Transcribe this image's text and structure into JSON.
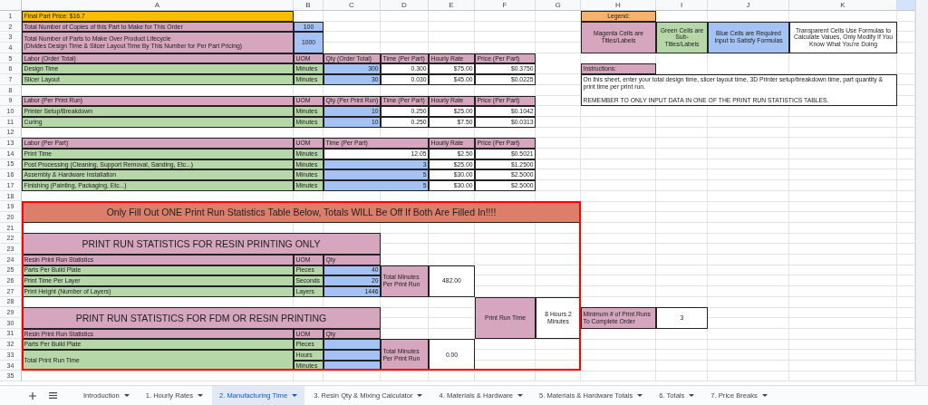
{
  "columns": [
    "A",
    "B",
    "C",
    "D",
    "E",
    "F",
    "G",
    "H",
    "I",
    "J",
    "K"
  ],
  "row_numbers": [
    "1",
    "2",
    "3",
    "4",
    "5",
    "6",
    "7",
    "8",
    "9",
    "10",
    "11",
    "12",
    "13",
    "14",
    "15",
    "16",
    "17",
    "18",
    "19",
    "20",
    "21",
    "22",
    "23",
    "24",
    "25",
    "26",
    "27",
    "28",
    "29",
    "30",
    "31",
    "32",
    "33",
    "34",
    "35"
  ],
  "sections": [
    {
      "cells": [
        {
          "kind": "price",
          "text": "Final Part Price: $16.7"
        },
        {
          "kind": "title",
          "text": "Total Number of Copies of this Part to Make for This Order"
        },
        {
          "kind": "input-centered",
          "text": "100"
        },
        {
          "kind": "title",
          "text": "Total Number of Parts to Make Over Product Lifecycle\n(Divides Design Time & Slicer Layout Time By This Number for Per Part Pricing)"
        },
        {
          "kind": "input-centered",
          "text": "1000"
        }
      ]
    },
    {
      "cells": [
        {
          "kind": "legend-title",
          "text": "Legend:"
        },
        {
          "kind": "title-centered",
          "text": "Magenta Cells are Titles/Labels"
        },
        {
          "kind": "subtitle-centered",
          "text": "Green Cells are Sub-Titles/Labels"
        },
        {
          "kind": "input-centered",
          "text": "Blue Cells are Required Input to Satisfy Formulas"
        },
        {
          "kind": "value-centered",
          "text": "Transparent Cells Use Formulas to Calculate Values, Only Modify If You Know What You're Doing"
        }
      ]
    },
    {
      "cells": [
        {
          "kind": "title",
          "text": "Instructions:"
        },
        {
          "kind": "note",
          "text": "On this sheet, enter your total design time, slicer layout time, 3D Printer setup/breakdown time, part quantity & print time per print run.\n\nREMEMBER TO ONLY INPUT DATA IN ONE OF THE PRINT RUN STATISTICS TABLES."
        }
      ]
    },
    {
      "cells": [
        {
          "kind": "title",
          "text": "Labor (Order Total)"
        },
        {
          "kind": "title",
          "text": "UOM"
        },
        {
          "kind": "title",
          "text": "Qty (Order Total)"
        },
        {
          "kind": "title",
          "text": "Time (Per Part)"
        },
        {
          "kind": "title",
          "text": "Hourly Rate"
        },
        {
          "kind": "title",
          "text": "Price (Per Part)"
        },
        {
          "kind": "subtitle",
          "text": "Design Time"
        },
        {
          "kind": "subtitle",
          "text": "Minutes"
        },
        {
          "kind": "input",
          "text": "300"
        },
        {
          "kind": "value",
          "text": "0.300"
        },
        {
          "kind": "value",
          "text": "$75.00"
        },
        {
          "kind": "value",
          "text": "$0.3750"
        },
        {
          "kind": "subtitle",
          "text": "Slicer Layout"
        },
        {
          "kind": "subtitle",
          "text": "Minutes"
        },
        {
          "kind": "input",
          "text": "30"
        },
        {
          "kind": "value",
          "text": "0.030"
        },
        {
          "kind": "value",
          "text": "$45.00"
        },
        {
          "kind": "value",
          "text": "$0.0225"
        }
      ]
    },
    {
      "cells": [
        {
          "kind": "title",
          "text": "Labor (Per Print Run)"
        },
        {
          "kind": "title",
          "text": "UOM"
        },
        {
          "kind": "title",
          "text": "Qty (Per Print Run)"
        },
        {
          "kind": "title",
          "text": "Time (Per Part)"
        },
        {
          "kind": "title",
          "text": "Hourly Rate"
        },
        {
          "kind": "title",
          "text": "Price (Per Part)"
        },
        {
          "kind": "subtitle",
          "text": "Printer Setup/Breakdown"
        },
        {
          "kind": "subtitle",
          "text": "Minutes"
        },
        {
          "kind": "input",
          "text": "10"
        },
        {
          "kind": "value",
          "text": "0.250"
        },
        {
          "kind": "value",
          "text": "$25.00"
        },
        {
          "kind": "value",
          "text": "$0.1042"
        },
        {
          "kind": "subtitle",
          "text": "Curing"
        },
        {
          "kind": "subtitle",
          "text": "Minutes"
        },
        {
          "kind": "input",
          "text": "10"
        },
        {
          "kind": "value",
          "text": "0.250"
        },
        {
          "kind": "value",
          "text": "$7.50"
        },
        {
          "kind": "value",
          "text": "$0.0313"
        }
      ]
    },
    {
      "cells": [
        {
          "kind": "title",
          "text": "Labor (Per Part)"
        },
        {
          "kind": "title",
          "text": "UOM"
        },
        {
          "kind": "title",
          "text": "Time (Per Part)"
        },
        {
          "kind": "title",
          "text": "Hourly Rate"
        },
        {
          "kind": "title",
          "text": "Price (Per Part)"
        },
        {
          "kind": "subtitle",
          "text": "Print Time"
        },
        {
          "kind": "subtitle",
          "text": "Minutes"
        },
        {
          "kind": "value",
          "text": "12.05"
        },
        {
          "kind": "value",
          "text": "$2.50"
        },
        {
          "kind": "value",
          "text": "$0.5021"
        },
        {
          "kind": "subtitle",
          "text": "Post Processing (Cleaning, Support Removal, Sanding, Etc...)"
        },
        {
          "kind": "subtitle",
          "text": "Minutes"
        },
        {
          "kind": "input",
          "text": "3"
        },
        {
          "kind": "value",
          "text": "$25.00"
        },
        {
          "kind": "value",
          "text": "$1.2500"
        },
        {
          "kind": "subtitle",
          "text": "Assembly & Hardware Installation"
        },
        {
          "kind": "subtitle",
          "text": "Minutes"
        },
        {
          "kind": "input",
          "text": "5"
        },
        {
          "kind": "value",
          "text": "$30.00"
        },
        {
          "kind": "value",
          "text": "$2.5000"
        },
        {
          "kind": "subtitle",
          "text": "Finishing (Painting, Packaging, Etc...)"
        },
        {
          "kind": "subtitle",
          "text": "Minutes"
        },
        {
          "kind": "input",
          "text": "5"
        },
        {
          "kind": "value",
          "text": "$30.00"
        },
        {
          "kind": "value",
          "text": "$2.5000"
        }
      ]
    },
    {
      "cells": [
        {
          "kind": "banner",
          "text": "Only Fill Out ONE Print Run Statistics Table Below, Totals WILL Be Off If Both Are Filled In!!!!"
        }
      ]
    },
    {
      "cells": [
        {
          "kind": "heading",
          "text": "PRINT RUN STATISTICS FOR RESIN PRINTING ONLY"
        },
        {
          "kind": "title",
          "text": "Resin Print Run Statistics"
        },
        {
          "kind": "title",
          "text": "UOM"
        },
        {
          "kind": "title",
          "text": "Qty"
        },
        {
          "kind": "subtitle",
          "text": "Parts Per Build Plate"
        },
        {
          "kind": "subtitle",
          "text": "Pieces"
        },
        {
          "kind": "input",
          "text": "40"
        },
        {
          "kind": "subtitle",
          "text": "Print Time Per Layer"
        },
        {
          "kind": "subtitle",
          "text": "Seconds"
        },
        {
          "kind": "input",
          "text": "20"
        },
        {
          "kind": "subtitle",
          "text": "Print Height (Number of Layers)"
        },
        {
          "kind": "subtitle",
          "text": "Layers"
        },
        {
          "kind": "input",
          "text": "1446"
        }
      ]
    },
    {
      "cells": [
        {
          "kind": "title-wrap",
          "text": "Total Minutes Per Print Run"
        },
        {
          "kind": "value-centered",
          "text": "482.00"
        }
      ]
    },
    {
      "cells": [
        {
          "kind": "heading",
          "text": "PRINT RUN STATISTICS FOR FDM OR RESIN PRINTING"
        },
        {
          "kind": "title",
          "text": "Resin Print Run Statistics"
        },
        {
          "kind": "title",
          "text": "UOM"
        },
        {
          "kind": "title",
          "text": "Qty"
        },
        {
          "kind": "subtitle",
          "text": "Parts Per Build Plate"
        },
        {
          "kind": "subtitle",
          "text": "Pieces"
        },
        {
          "kind": "input"
        },
        {
          "kind": "subtitle",
          "text": "Total Print Run Time"
        },
        {
          "kind": "subtitle",
          "text": "Hours"
        },
        {
          "kind": "input"
        },
        {
          "kind": "subtitle",
          "text": "Minutes"
        },
        {
          "kind": "input"
        }
      ]
    },
    {
      "cells": [
        {
          "kind": "title-wrap",
          "text": "Total Minutes Per Print Run"
        },
        {
          "kind": "value-centered",
          "text": "0.00"
        }
      ]
    },
    {
      "cells": [
        {
          "kind": "title-centered",
          "text": "Print Run Time"
        },
        {
          "kind": "value-centered",
          "text": "8 Hours 2 Minutes"
        }
      ]
    },
    {
      "cells": [
        {
          "kind": "title-wrap",
          "text": "Minimum # of Print Runs To Complete Order"
        },
        {
          "kind": "value-centered",
          "text": "3"
        }
      ]
    }
  ],
  "tabs": [
    {
      "label": "Introduction",
      "selected": false
    },
    {
      "label": "1. Hourly Rates",
      "selected": false
    },
    {
      "label": "2. Manufacturing Time",
      "selected": true
    },
    {
      "label": "3. Resin Qty & Mixing Calculator",
      "selected": false
    },
    {
      "label": "4.  Materials & Hardware",
      "selected": false
    },
    {
      "label": "5. Materials & Hardware Totals",
      "selected": false
    },
    {
      "label": "6. Totals",
      "selected": false
    },
    {
      "label": "7. Price Breaks",
      "selected": false
    }
  ]
}
